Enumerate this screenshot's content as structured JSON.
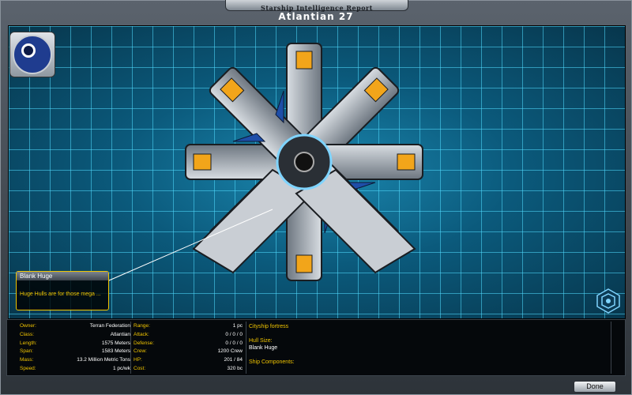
{
  "window": {
    "title": "Starship Intelligence Report"
  },
  "ship": {
    "name": "Atlantian 27"
  },
  "emblem": {
    "icon": "terran-federation-emblem-icon"
  },
  "callout": {
    "title": "Blank Huge",
    "description": "Huge Hulls are for those mega ..."
  },
  "stats_left": [
    {
      "label": "Owner:",
      "value": "Terran Federation"
    },
    {
      "label": "Class:",
      "value": "Atlantian"
    },
    {
      "label": "Length:",
      "value": "1575 Meters"
    },
    {
      "label": "Span:",
      "value": "1583 Meters"
    },
    {
      "label": "Mass:",
      "value": "13.2 Million Metric Tons"
    },
    {
      "label": "Speed:",
      "value": "1 pc/wk"
    }
  ],
  "stats_mid": [
    {
      "label": "Range:",
      "value": "1 pc"
    },
    {
      "label": "Attack:",
      "value": "0 / 0 / 0"
    },
    {
      "label": "Defense:",
      "value": "0 / 0 / 0"
    },
    {
      "label": "Crew:",
      "value": "1200 Crew"
    },
    {
      "label": "HP:",
      "value": "201 / 84"
    },
    {
      "label": "Cost:",
      "value": "320 bc"
    }
  ],
  "details": {
    "role": "Cityship fortress",
    "hull_size_label": "Hull Size:",
    "hull_size_value": "Blank Huge",
    "components_label": "Ship Components:"
  },
  "buttons": {
    "done": "Done"
  },
  "colors": {
    "accent": "#f0c400",
    "grid": "#50dcff",
    "background": "#0a4f6e"
  }
}
